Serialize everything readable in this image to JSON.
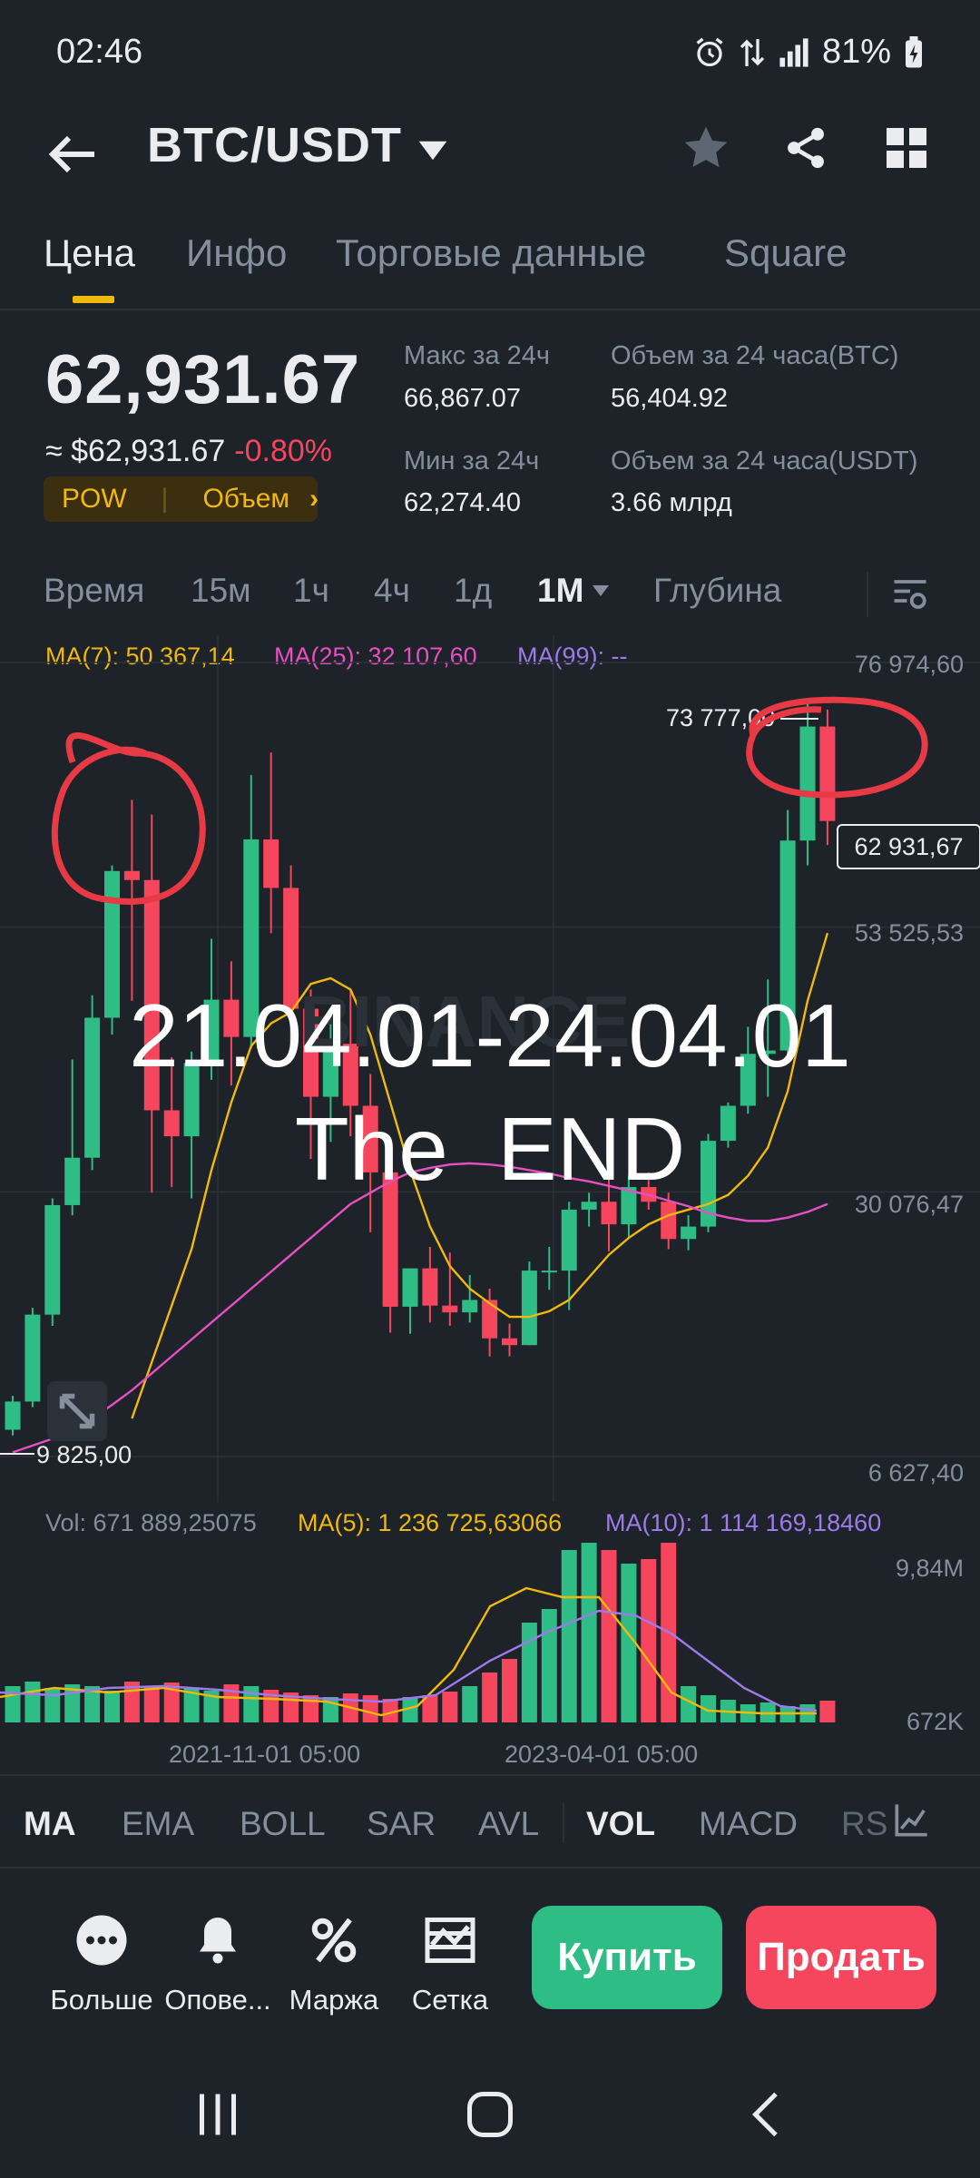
{
  "status_bar": {
    "time": "02:46",
    "battery": "81%"
  },
  "header": {
    "pair": "BTC/USDT"
  },
  "tabs": [
    "Цена",
    "Инфо",
    "Торговые данные",
    "Square"
  ],
  "price": {
    "last": "62,931.67",
    "usd": "≈ $62,931.67",
    "change": "-0.80%",
    "badge_left": "POW",
    "badge_right": "Объем",
    "high_label": "Макс за 24ч",
    "high": "66,867.07",
    "low_label": "Мин за 24ч",
    "low": "62,274.40",
    "vol_btc_label": "Объем за 24 часа(BTC)",
    "vol_btc": "56,404.92",
    "vol_usdt_label": "Объем за 24 часа(USDT)",
    "vol_usdt": "3.66 млрд"
  },
  "intervals": [
    "Время",
    "15м",
    "1ч",
    "4ч",
    "1д",
    "1M",
    "Глубина"
  ],
  "active_interval": "1M",
  "chart": {
    "ma7": "MA(7): 50 367,14",
    "ma25": "MA(25): 32 107,60",
    "ma99": "MA(99): --",
    "y_top": "76 974,60",
    "y_53": "53 525,53",
    "y_30": "30 076,47",
    "y_low": "6 627,40",
    "price_tag": "62 931,67",
    "high_annot": "73 777,00",
    "low_annot": "9 825,00",
    "overlay_line1": "21.04.01-24.04.01",
    "overlay_line2": "The  END",
    "watermark": "BINANCE"
  },
  "volume": {
    "vol": "Vol: 671 889,25075",
    "ma5": "MA(5): 1 236 725,63066",
    "ma10": "MA(10): 1 114 169,18460",
    "y_top": "9,84M",
    "y_low": "672K",
    "x1": "2021-11-01 05:00",
    "x2": "2023-04-01 05:00"
  },
  "chart_data": {
    "type": "candlestick",
    "ylim": [
      6627.4,
      76974.6
    ],
    "candles": [
      {
        "o": 9000,
        "h": 12000,
        "l": 8500,
        "c": 11500
      },
      {
        "o": 11500,
        "h": 19800,
        "l": 11000,
        "c": 19200
      },
      {
        "o": 19200,
        "h": 29500,
        "l": 18200,
        "c": 28900
      },
      {
        "o": 28900,
        "h": 41800,
        "l": 28000,
        "c": 33100
      },
      {
        "o": 33100,
        "h": 47500,
        "l": 32000,
        "c": 45500
      },
      {
        "o": 45500,
        "h": 59000,
        "l": 44000,
        "c": 58500
      },
      {
        "o": 58500,
        "h": 64800,
        "l": 47000,
        "c": 57700
      },
      {
        "o": 57700,
        "h": 63500,
        "l": 30000,
        "c": 37300
      },
      {
        "o": 37300,
        "h": 42000,
        "l": 30500,
        "c": 35000
      },
      {
        "o": 35000,
        "h": 42500,
        "l": 29500,
        "c": 41500
      },
      {
        "o": 41500,
        "h": 52500,
        "l": 40000,
        "c": 47100
      },
      {
        "o": 47100,
        "h": 50500,
        "l": 39500,
        "c": 43800
      },
      {
        "o": 43800,
        "h": 67000,
        "l": 42800,
        "c": 61300
      },
      {
        "o": 61300,
        "h": 69000,
        "l": 53000,
        "c": 57000
      },
      {
        "o": 57000,
        "h": 59000,
        "l": 42000,
        "c": 46300
      },
      {
        "o": 46300,
        "h": 48000,
        "l": 33000,
        "c": 38500
      },
      {
        "o": 38500,
        "h": 45000,
        "l": 34500,
        "c": 43200
      },
      {
        "o": 43200,
        "h": 48000,
        "l": 35000,
        "c": 37700
      },
      {
        "o": 37700,
        "h": 40500,
        "l": 26500,
        "c": 31800
      },
      {
        "o": 31800,
        "h": 32400,
        "l": 17600,
        "c": 19900
      },
      {
        "o": 19900,
        "h": 22000,
        "l": 17500,
        "c": 23300
      },
      {
        "o": 23300,
        "h": 25200,
        "l": 18500,
        "c": 20000
      },
      {
        "o": 20000,
        "h": 24700,
        "l": 18200,
        "c": 19400
      },
      {
        "o": 19400,
        "h": 22700,
        "l": 18500,
        "c": 20500
      },
      {
        "o": 20500,
        "h": 21500,
        "l": 15500,
        "c": 17100
      },
      {
        "o": 17100,
        "h": 18400,
        "l": 15500,
        "c": 16500
      },
      {
        "o": 16500,
        "h": 23900,
        "l": 16500,
        "c": 23100
      },
      {
        "o": 23100,
        "h": 25200,
        "l": 21400,
        "c": 23100
      },
      {
        "o": 23100,
        "h": 29200,
        "l": 19600,
        "c": 28500
      },
      {
        "o": 28500,
        "h": 30000,
        "l": 27000,
        "c": 29200
      },
      {
        "o": 29200,
        "h": 31800,
        "l": 24800,
        "c": 27200
      },
      {
        "o": 27200,
        "h": 31500,
        "l": 26000,
        "c": 30500
      },
      {
        "o": 30500,
        "h": 31800,
        "l": 28500,
        "c": 29200
      },
      {
        "o": 29200,
        "h": 30000,
        "l": 25000,
        "c": 25900
      },
      {
        "o": 25900,
        "h": 28000,
        "l": 24900,
        "c": 27000
      },
      {
        "o": 27000,
        "h": 35200,
        "l": 26500,
        "c": 34600
      },
      {
        "o": 34600,
        "h": 38000,
        "l": 34000,
        "c": 37700
      },
      {
        "o": 37700,
        "h": 44700,
        "l": 37000,
        "c": 42300
      },
      {
        "o": 42300,
        "h": 48900,
        "l": 38500,
        "c": 42600
      },
      {
        "o": 42600,
        "h": 63900,
        "l": 41800,
        "c": 61200
      },
      {
        "o": 61200,
        "h": 73777,
        "l": 59000,
        "c": 71300
      },
      {
        "o": 71300,
        "h": 72800,
        "l": 60800,
        "c": 62931.67
      }
    ],
    "ma7": [
      null,
      null,
      null,
      null,
      null,
      null,
      10000,
      15000,
      20000,
      25000,
      32000,
      38000,
      43000,
      45000,
      46000,
      48500,
      49000,
      48000,
      44000,
      38000,
      32000,
      27000,
      23500,
      21500,
      20200,
      19000,
      19000,
      19500,
      20500,
      22500,
      24500,
      26000,
      27200,
      28000,
      28500,
      29000,
      29800,
      31500,
      34000,
      39000,
      47000,
      53000
    ],
    "ma25": [
      7000,
      7600,
      8200,
      9000,
      10000,
      11200,
      12500,
      14000,
      15500,
      17000,
      18500,
      20000,
      21500,
      23000,
      24500,
      26000,
      27500,
      29000,
      30000,
      31000,
      31800,
      32200,
      32500,
      32600,
      32500,
      32300,
      32000,
      31700,
      31300,
      31000,
      30600,
      30200,
      29800,
      29300,
      28800,
      28200,
      27800,
      27500,
      27500,
      27800,
      28300,
      29000
    ]
  }
}
